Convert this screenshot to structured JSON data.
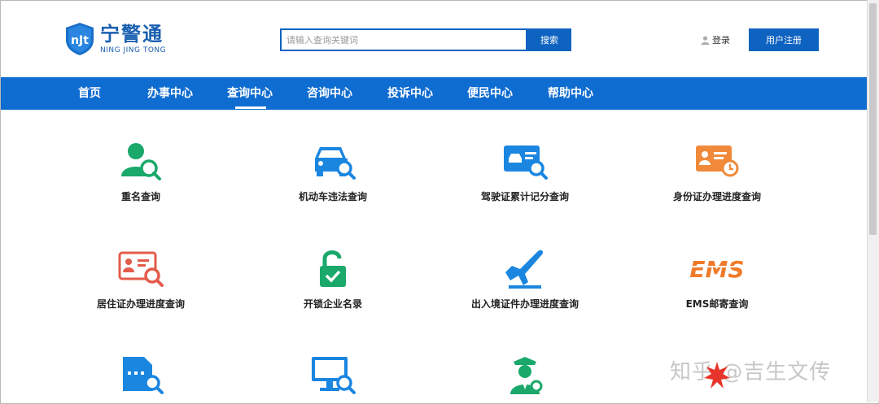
{
  "header": {
    "logo_cn": "宁警通",
    "logo_en": "NING JING TONG",
    "logo_mark": "nJt",
    "search_placeholder": "请输入查询关键词",
    "search_button": "搜索",
    "login": "登录",
    "register": "用户注册"
  },
  "nav": {
    "items": [
      "首页",
      "办事中心",
      "查询中心",
      "咨询中心",
      "投诉中心",
      "便民中心",
      "帮助中心"
    ],
    "active_index": 2
  },
  "services": [
    {
      "label": "重名查询",
      "icon": "person-search-icon",
      "color": "#1aa86b"
    },
    {
      "label": "机动车违法查询",
      "icon": "car-search-icon",
      "color": "#1a86e0"
    },
    {
      "label": "驾驶证累计记分查询",
      "icon": "license-search-icon",
      "color": "#1a86e0"
    },
    {
      "label": "身份证办理进度查询",
      "icon": "id-card-clock-icon",
      "color": "#f08a3a"
    },
    {
      "label": "居住证办理进度查询",
      "icon": "residence-card-search-icon",
      "color": "#e35b4a"
    },
    {
      "label": "开锁企业名录",
      "icon": "unlock-icon",
      "color": "#1aa86b"
    },
    {
      "label": "出入境证件办理进度查询",
      "icon": "airplane-icon",
      "color": "#1a86e0"
    },
    {
      "label": "EMS邮寄查询",
      "icon": "ems-logo",
      "color": "#f07a2a"
    },
    {
      "label": "",
      "icon": "document-search-icon",
      "color": "#1a86e0"
    },
    {
      "label": "",
      "icon": "monitor-search-icon",
      "color": "#1a86e0"
    },
    {
      "label": "",
      "icon": "police-officer-icon",
      "color": "#1aa86b"
    }
  ],
  "ems_text": "EMS",
  "watermark": "知乎 @吉生文传",
  "colors": {
    "brand": "#0f63c0",
    "nav": "#0f6cd0"
  }
}
